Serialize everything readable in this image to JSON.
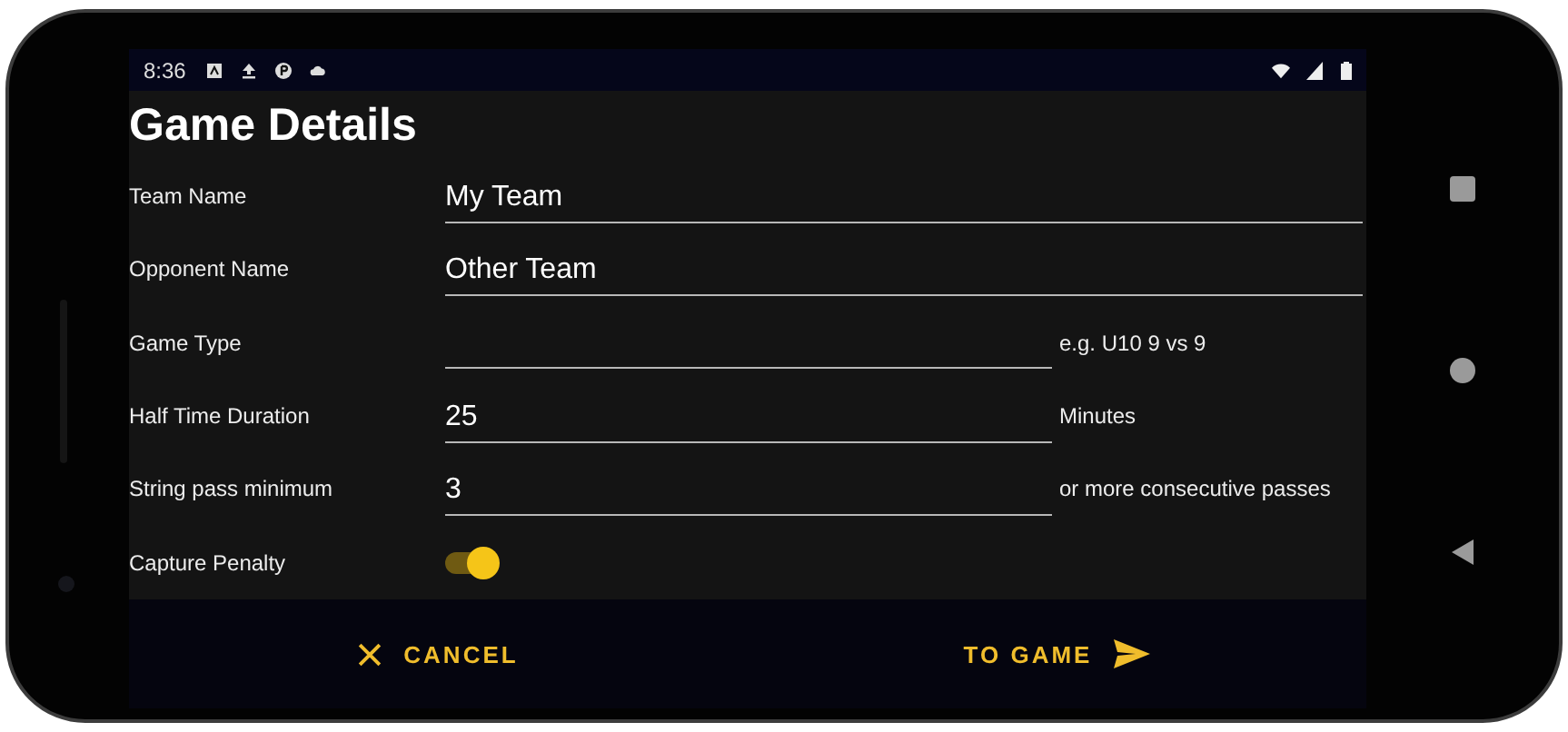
{
  "status_bar": {
    "time": "8:36"
  },
  "title": "Game Details",
  "fields": [
    {
      "kind": "text",
      "label": "Team Name",
      "value": "My Team"
    },
    {
      "kind": "text",
      "label": "Opponent Name",
      "value": "Other Team"
    },
    {
      "kind": "text",
      "label": "Game Type",
      "suffix": "e.g. U10 9 vs 9"
    },
    {
      "kind": "text",
      "label": "Half Time Duration",
      "value": "25",
      "suffix": "Minutes"
    },
    {
      "kind": "text",
      "label": "String pass minimum",
      "value": "3",
      "suffix": "or more consecutive passes"
    },
    {
      "kind": "switch",
      "label": "Capture Penalty",
      "on": true
    }
  ],
  "actions": [
    {
      "kind": "cancel",
      "label": "CANCEL"
    },
    {
      "kind": "confirm",
      "label": "TO GAME"
    }
  ]
}
